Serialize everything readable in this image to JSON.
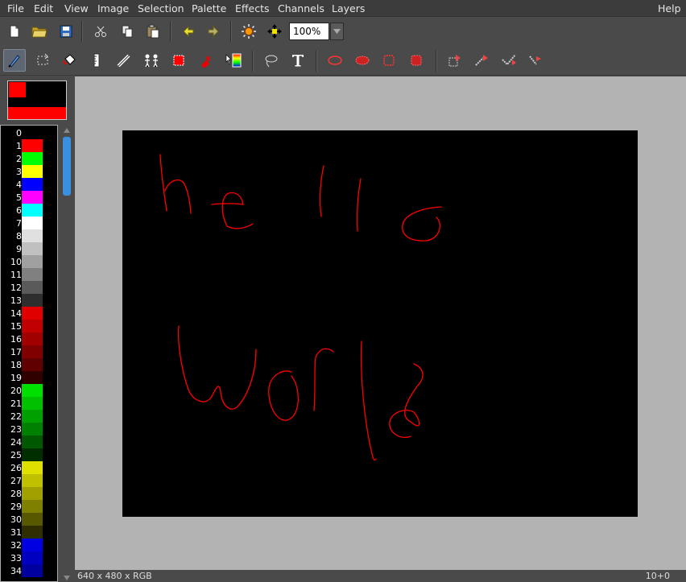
{
  "menubar": {
    "file": "File",
    "edit": "Edit",
    "view": "View",
    "image": "Image",
    "selection": "Selection",
    "palette": "Palette",
    "effects": "Effects",
    "channels": "Channels",
    "layers": "Layers",
    "help": "Help"
  },
  "toolbar": {
    "zoom_value": "100%"
  },
  "colors": {
    "foreground": "#ff0000",
    "background": "#ff0000",
    "canvas_bg": "#000000",
    "stroke": "#ff0000",
    "workspace": "#b3b3b3"
  },
  "palette": [
    {
      "index": "0",
      "color": "#000000"
    },
    {
      "index": "1",
      "color": "#ff0000"
    },
    {
      "index": "2",
      "color": "#00ff00"
    },
    {
      "index": "3",
      "color": "#ffff00"
    },
    {
      "index": "4",
      "color": "#0000ff"
    },
    {
      "index": "5",
      "color": "#ff00ff"
    },
    {
      "index": "6",
      "color": "#00ffff"
    },
    {
      "index": "7",
      "color": "#ffffff"
    },
    {
      "index": "8",
      "color": "#e0e0e0"
    },
    {
      "index": "9",
      "color": "#c0c0c0"
    },
    {
      "index": "10",
      "color": "#a0a0a0"
    },
    {
      "index": "11",
      "color": "#808080"
    },
    {
      "index": "12",
      "color": "#5a5a5a"
    },
    {
      "index": "13",
      "color": "#2e2e2e"
    },
    {
      "index": "14",
      "color": "#e00000"
    },
    {
      "index": "15",
      "color": "#c00000"
    },
    {
      "index": "16",
      "color": "#a00000"
    },
    {
      "index": "17",
      "color": "#800000"
    },
    {
      "index": "18",
      "color": "#600000"
    },
    {
      "index": "19",
      "color": "#300000"
    },
    {
      "index": "20",
      "color": "#00e000"
    },
    {
      "index": "21",
      "color": "#00c000"
    },
    {
      "index": "22",
      "color": "#00a000"
    },
    {
      "index": "23",
      "color": "#008000"
    },
    {
      "index": "24",
      "color": "#005800"
    },
    {
      "index": "25",
      "color": "#002e00"
    },
    {
      "index": "26",
      "color": "#e0e000"
    },
    {
      "index": "27",
      "color": "#c0c000"
    },
    {
      "index": "28",
      "color": "#a0a000"
    },
    {
      "index": "29",
      "color": "#808000"
    },
    {
      "index": "30",
      "color": "#585800"
    },
    {
      "index": "31",
      "color": "#2e2e00"
    },
    {
      "index": "32",
      "color": "#0000e0"
    },
    {
      "index": "33",
      "color": "#0000c0"
    },
    {
      "index": "34",
      "color": "#0000a0"
    }
  ],
  "status": {
    "image_info": "640 x 480 x RGB",
    "position": "10+0"
  },
  "icons": {
    "toolbar1": [
      "new-file-icon",
      "open-folder-icon",
      "save-icon",
      "cut-icon",
      "copy-icon",
      "paste-icon",
      "undo-icon",
      "redo-icon",
      "brightness-icon",
      "move-view-icon"
    ],
    "toolbar2": [
      "paint-brush-icon",
      "crop-select-icon",
      "fill-bucket-icon",
      "ruler-icon",
      "line-pen-icon",
      "clone-icon",
      "rectangle-icon",
      "spray-icon",
      "gradient-icon",
      "lasso-icon",
      "text-icon",
      "ellipse-select-icon",
      "ellipse-fill-icon",
      "rect-select-icon",
      "rect-fill-icon",
      "brush-preset-1-icon",
      "brush-preset-2-icon",
      "brush-preset-3-icon",
      "brush-preset-4-icon"
    ]
  }
}
